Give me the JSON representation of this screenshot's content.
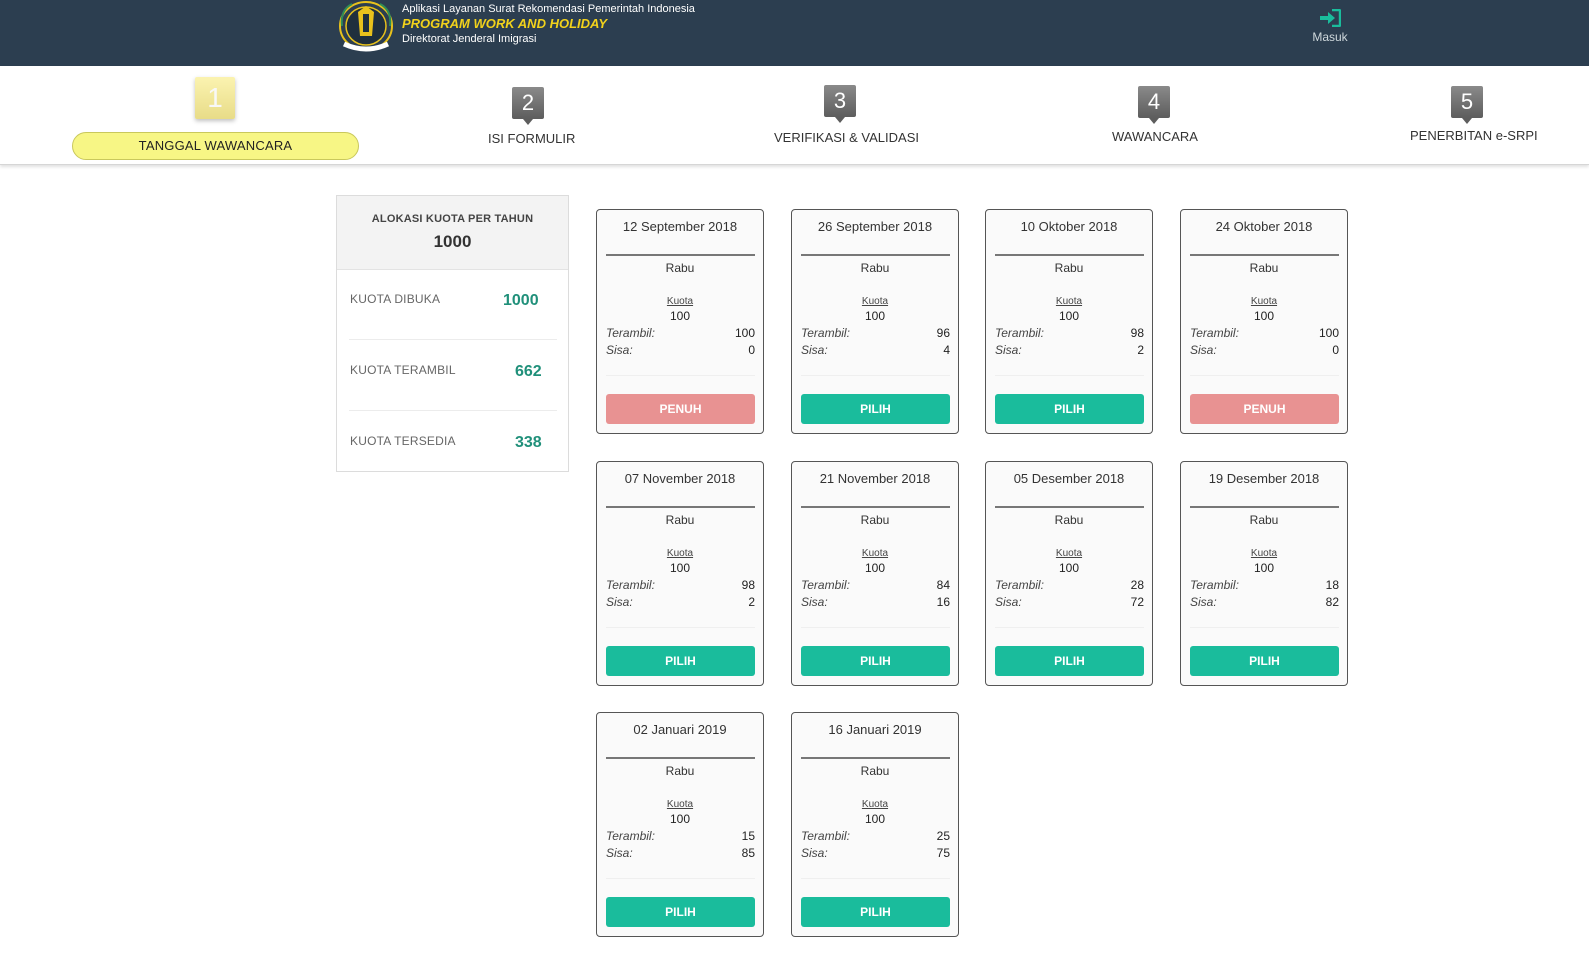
{
  "header": {
    "line1": "Aplikasi Layanan Surat Rekomendasi Pemerintah Indonesia",
    "line2": "PROGRAM WORK AND HOLIDAY",
    "line3": "Direktorat Jenderal Imigrasi",
    "login_label": "Masuk",
    "login_icon": "sign-in-icon",
    "logo_icon": "imigrasi-emblem-icon"
  },
  "steps": [
    {
      "number": "1",
      "label": "TANGGAL  WAWANCARA",
      "active": true
    },
    {
      "number": "2",
      "label": "ISI FORMULIR",
      "active": false
    },
    {
      "number": "3",
      "label": "VERIFIKASI & VALIDASI",
      "active": false
    },
    {
      "number": "4",
      "label": "WAWANCARA",
      "active": false
    },
    {
      "number": "5",
      "label": "PENERBITAN e-SRPI",
      "active": false
    }
  ],
  "quota": {
    "title": "ALOKASI KUOTA PER TAHUN",
    "total": "1000",
    "rows": [
      {
        "label": "KUOTA DIBUKA",
        "value": "1000"
      },
      {
        "label": "KUOTA TERAMBIL",
        "value": "662"
      },
      {
        "label": "KUOTA TERSEDIA",
        "value": "338"
      }
    ]
  },
  "card_labels": {
    "kuota": "Kuota",
    "terambil": "Terambil:",
    "sisa": "Sisa:"
  },
  "cards": [
    {
      "date": "12 September 2018",
      "day": "Rabu",
      "kuota": "100",
      "terambil": "100",
      "sisa": "0",
      "button": "PENUH",
      "status": "penuh"
    },
    {
      "date": "26 September 2018",
      "day": "Rabu",
      "kuota": "100",
      "terambil": "96",
      "sisa": "4",
      "button": "PILIH",
      "status": "pilih"
    },
    {
      "date": "10 Oktober 2018",
      "day": "Rabu",
      "kuota": "100",
      "terambil": "98",
      "sisa": "2",
      "button": "PILIH",
      "status": "pilih"
    },
    {
      "date": "24 Oktober 2018",
      "day": "Rabu",
      "kuota": "100",
      "terambil": "100",
      "sisa": "0",
      "button": "PENUH",
      "status": "penuh"
    },
    {
      "date": "07 November 2018",
      "day": "Rabu",
      "kuota": "100",
      "terambil": "98",
      "sisa": "2",
      "button": "PILIH",
      "status": "pilih"
    },
    {
      "date": "21 November 2018",
      "day": "Rabu",
      "kuota": "100",
      "terambil": "84",
      "sisa": "16",
      "button": "PILIH",
      "status": "pilih"
    },
    {
      "date": "05 Desember 2018",
      "day": "Rabu",
      "kuota": "100",
      "terambil": "28",
      "sisa": "72",
      "button": "PILIH",
      "status": "pilih"
    },
    {
      "date": "19 Desember 2018",
      "day": "Rabu",
      "kuota": "100",
      "terambil": "18",
      "sisa": "82",
      "button": "PILIH",
      "status": "pilih"
    },
    {
      "date": "02 Januari 2019",
      "day": "Rabu",
      "kuota": "100",
      "terambil": "15",
      "sisa": "85",
      "button": "PILIH",
      "status": "pilih"
    },
    {
      "date": "16 Januari 2019",
      "day": "Rabu",
      "kuota": "100",
      "terambil": "25",
      "sisa": "75",
      "button": "PILIH",
      "status": "pilih"
    }
  ],
  "colors": {
    "header_bg": "#2c3e50",
    "title_yellow": "#f2d21b",
    "pilih_button": "#1abc9c",
    "penuh_button": "#e89292",
    "quota_value": "#20907a",
    "active_step_pill": "#f7f685"
  }
}
